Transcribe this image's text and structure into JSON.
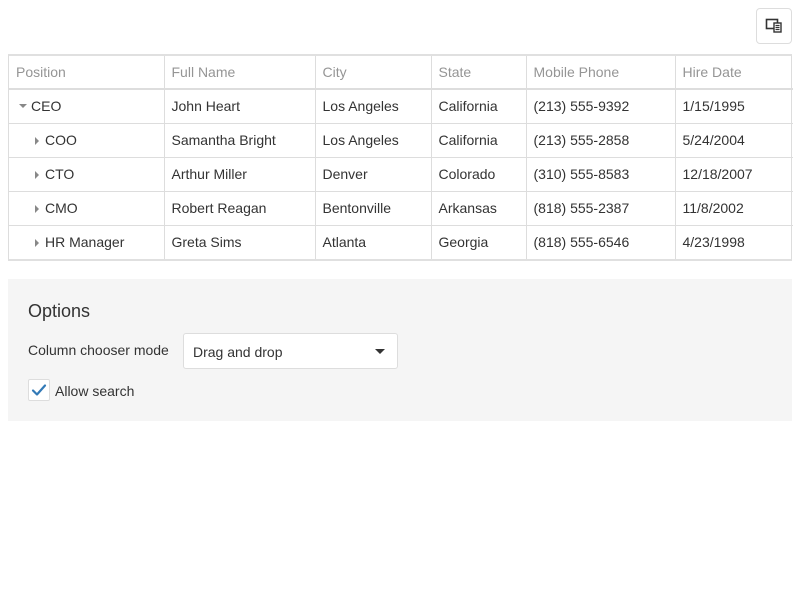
{
  "toolbar": {
    "column_chooser_icon": "column-chooser-icon"
  },
  "grid": {
    "columns": [
      "Position",
      "Full Name",
      "City",
      "State",
      "Mobile Phone",
      "Hire Date"
    ],
    "rows": [
      {
        "position": "CEO",
        "full_name": "John Heart",
        "city": "Los Angeles",
        "state": "California",
        "mobile_phone": "(213) 555-9392",
        "hire_date": "1/15/1995",
        "expander": "expanded"
      },
      {
        "position": "COO",
        "full_name": "Samantha Bright",
        "city": "Los Angeles",
        "state": "California",
        "mobile_phone": "(213) 555-2858",
        "hire_date": "5/24/2004",
        "expander": "collapsed"
      },
      {
        "position": "CTO",
        "full_name": "Arthur Miller",
        "city": "Denver",
        "state": "Colorado",
        "mobile_phone": "(310) 555-8583",
        "hire_date": "12/18/2007",
        "expander": "collapsed"
      },
      {
        "position": "CMO",
        "full_name": "Robert Reagan",
        "city": "Bentonville",
        "state": "Arkansas",
        "mobile_phone": "(818) 555-2387",
        "hire_date": "11/8/2002",
        "expander": "collapsed"
      },
      {
        "position": "HR Manager",
        "full_name": "Greta Sims",
        "city": "Atlanta",
        "state": "Georgia",
        "mobile_phone": "(818) 555-6546",
        "hire_date": "4/23/1998",
        "expander": "collapsed"
      }
    ]
  },
  "options": {
    "title": "Options",
    "column_chooser_mode_label": "Column chooser mode",
    "column_chooser_mode_value": "Drag and drop",
    "allow_search_label": "Allow search",
    "allow_search_checked": true
  },
  "colors": {
    "accent": "#337ab7",
    "border": "#dddddd",
    "header_text": "#959595",
    "panel_bg": "#f5f5f5"
  }
}
